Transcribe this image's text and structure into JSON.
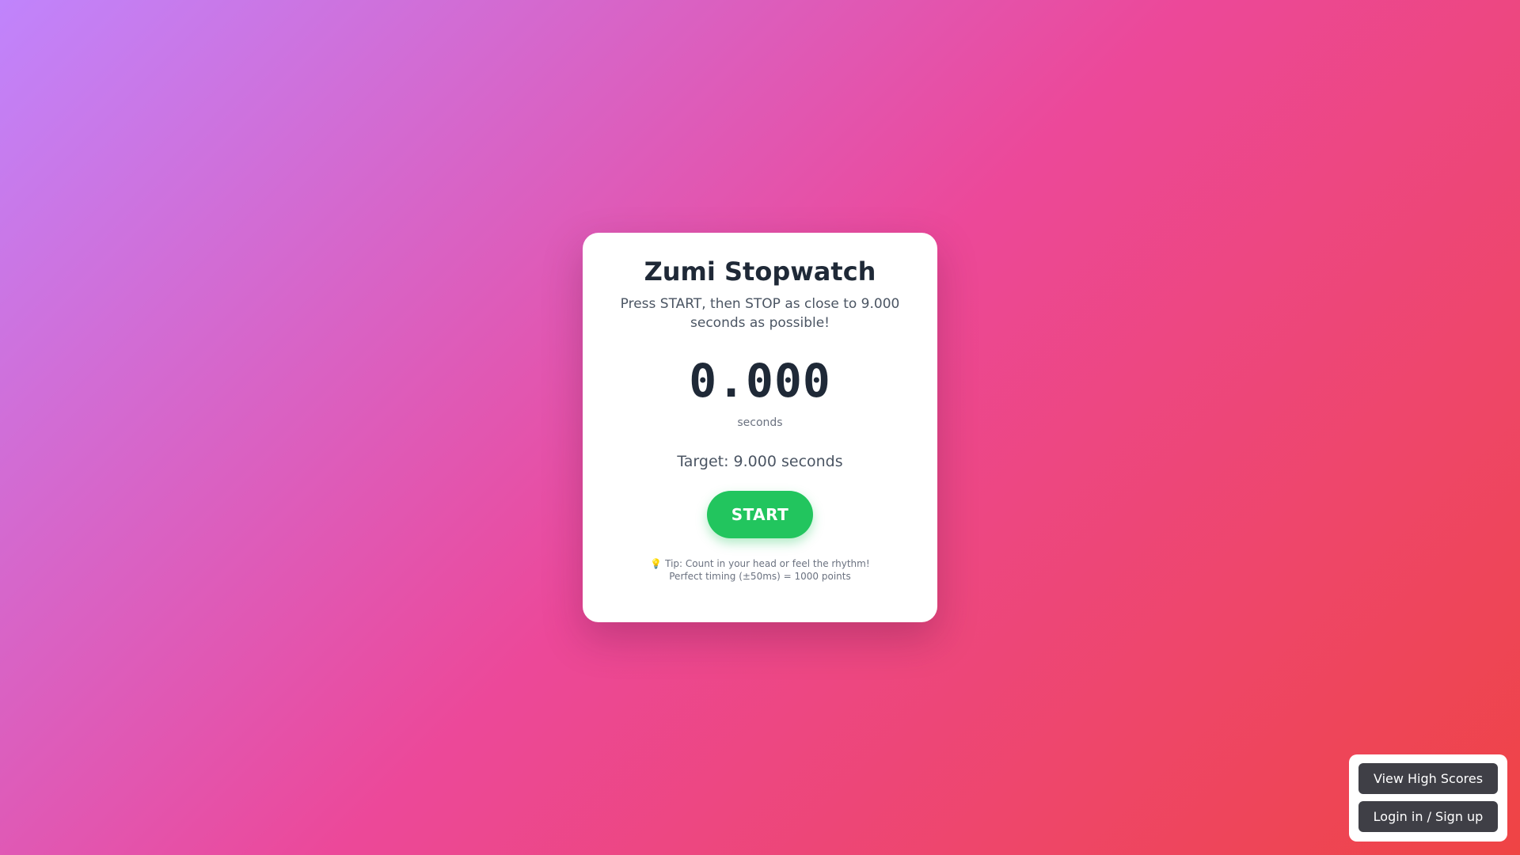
{
  "game": {
    "title": "Zumi Stopwatch",
    "instructions": "Press START, then STOP as close to 9.000 seconds as possible!",
    "timer_value": "0.000",
    "timer_unit": "seconds",
    "target_text": "Target: 9.000 seconds",
    "start_label": "START",
    "tip_icon": "lightbulb-icon",
    "tip_line1": "Tip: Count in your head or feel the rhythm!",
    "tip_line2": "Perfect timing (±50ms) = 1000 points"
  },
  "corner_menu": {
    "high_scores_label": "View High Scores",
    "login_label": "Login in / Sign up"
  },
  "colors": {
    "background_gradient": [
      "#c084fc",
      "#ec4899",
      "#ef4444"
    ],
    "start_button": "#22c55e",
    "corner_button": "#3f3f46",
    "title_text": "#1f2937"
  }
}
